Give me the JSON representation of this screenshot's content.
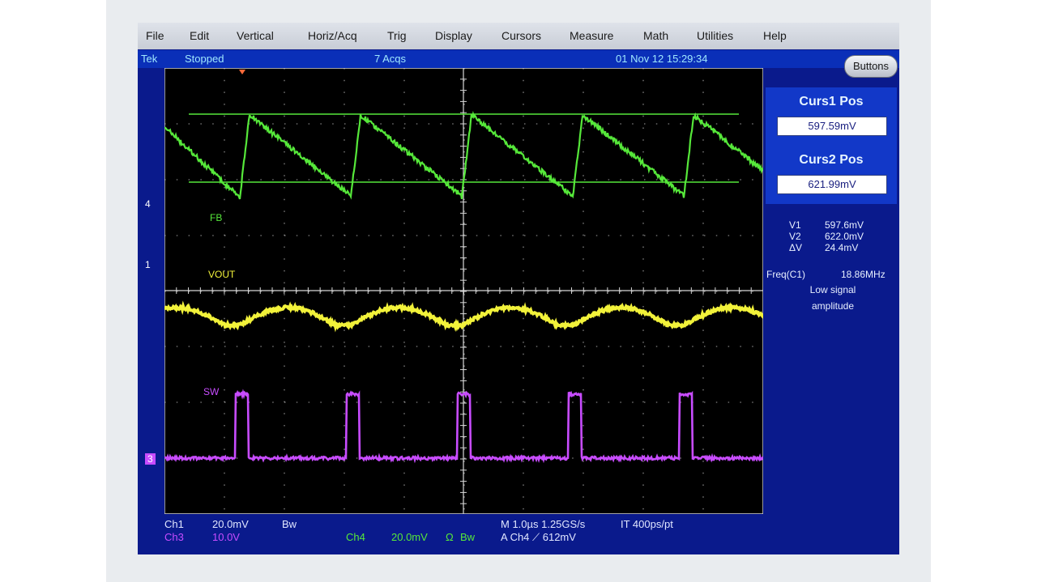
{
  "menu": [
    "File",
    "Edit",
    "Vertical",
    "Horiz/Acq",
    "Trig",
    "Display",
    "Cursors",
    "Measure",
    "Math",
    "Utilities",
    "Help"
  ],
  "status": {
    "brand": "Tek",
    "state": "Stopped",
    "acqs": "7 Acqs",
    "datetime": "01 Nov 12 15:29:34"
  },
  "buttons_label": "Buttons",
  "curs1": {
    "title": "Curs1 Pos",
    "value": "597.59mV"
  },
  "curs2": {
    "title": "Curs2 Pos",
    "value": "621.99mV"
  },
  "readouts": {
    "v1_label": "V1",
    "v1_value": "597.6mV",
    "v2_label": "V2",
    "v2_value": "622.0mV",
    "dv_label": "ΔV",
    "dv_value": "24.4mV",
    "freq_label": "Freq(C1)",
    "freq_value": "18.86MHz",
    "note": "Low signal amplitude"
  },
  "trace_labels": {
    "fb": "FB",
    "vout": "VOUT",
    "sw": "SW"
  },
  "channel_markers": {
    "ch4": "4",
    "ch1": "1",
    "ch3": "3"
  },
  "bottom": {
    "ch1": "Ch1",
    "ch1_scale": "20.0mV",
    "ch1_bw": "Bw",
    "ch3": "Ch3",
    "ch3_scale": "10.0V",
    "ch4": "Ch4",
    "ch4_scale": "20.0mV",
    "ch4_ohm": "Ω",
    "ch4_bw": "Bw",
    "timebase": "M 1.0µs 1.25GS/s",
    "trigger": "A  Ch4  ⟋  612mV",
    "it": "IT 400ps/pt"
  },
  "colors": {
    "fb": "#56e83a",
    "vout": "#f2f23a",
    "sw": "#c84cff",
    "grid": "#d8d8d8"
  }
}
